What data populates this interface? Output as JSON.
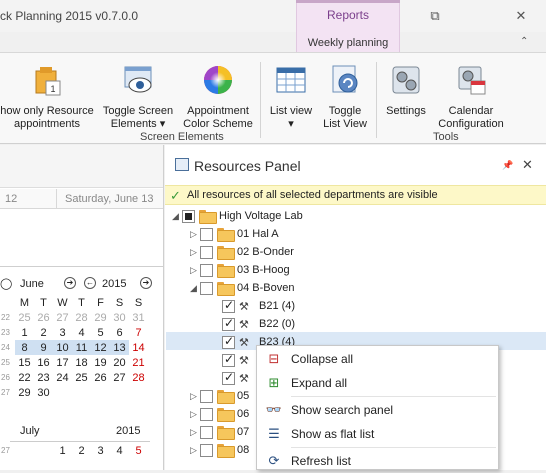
{
  "window": {
    "title": "ck Planning 2015 v0.7.0.0"
  },
  "ribbon_tabs": {
    "context_label": "Reports",
    "tab_label": "Weekly planning"
  },
  "ribbon": {
    "buttons": [
      {
        "label": "how only Resource\nappointments"
      },
      {
        "label": "Toggle Screen\nElements ▾"
      },
      {
        "label": "Appointment\nColor Scheme"
      },
      {
        "label": "List view\n▾"
      },
      {
        "label": "Toggle\nList View"
      },
      {
        "label": "Settings"
      },
      {
        "label": "Calendar\nConfiguration"
      }
    ],
    "groups": [
      "Screen Elements",
      "Tools"
    ]
  },
  "scheduler": {
    "day_left": "12",
    "day_right": "Saturday, June 13"
  },
  "calendar": {
    "june": {
      "month": "June",
      "year": "2015",
      "weekdays": [
        "M",
        "T",
        "W",
        "T",
        "F",
        "S",
        "S"
      ],
      "weeks": [
        {
          "wk": "22",
          "days": [
            "25",
            "26",
            "27",
            "28",
            "29",
            "30",
            "31"
          ]
        },
        {
          "wk": "23",
          "days": [
            "1",
            "2",
            "3",
            "4",
            "5",
            "6",
            "7"
          ]
        },
        {
          "wk": "24",
          "days": [
            "8",
            "9",
            "10",
            "11",
            "12",
            "13",
            "14"
          ]
        },
        {
          "wk": "25",
          "days": [
            "15",
            "16",
            "17",
            "18",
            "19",
            "20",
            "21"
          ]
        },
        {
          "wk": "26",
          "days": [
            "22",
            "23",
            "24",
            "25",
            "26",
            "27",
            "28"
          ]
        },
        {
          "wk": "27",
          "days": [
            "29",
            "30",
            "",
            "",
            "",
            "",
            ""
          ]
        }
      ]
    },
    "july": {
      "month": "July",
      "year": "2015",
      "weeks": [
        {
          "wk": "27",
          "days": [
            "",
            "",
            "1",
            "2",
            "3",
            "4",
            "5"
          ]
        }
      ]
    }
  },
  "panel": {
    "title": "Resources Panel",
    "banner": "All resources of all selected departments are visible",
    "tree": [
      {
        "label": "High Voltage Lab"
      },
      {
        "label": "01 Hal A"
      },
      {
        "label": "02 B-Onder"
      },
      {
        "label": "03 B-Hoog"
      },
      {
        "label": "04 B-Boven"
      },
      {
        "label": "B21 (4)"
      },
      {
        "label": "B22 (0)"
      },
      {
        "label": "B23 (4)"
      },
      {
        "label": "05 "
      },
      {
        "label": "06 "
      },
      {
        "label": "07 "
      },
      {
        "label": "08 "
      }
    ]
  },
  "context_menu": {
    "items": [
      {
        "label": "Collapse all",
        "icon": "collapse-all-icon"
      },
      {
        "label": "Expand all",
        "icon": "expand-all-icon"
      },
      {
        "label": "Show search panel",
        "icon": "binoculars-icon"
      },
      {
        "label": "Show as flat list",
        "icon": "list-icon"
      },
      {
        "label": "Refresh list",
        "icon": "refresh-icon"
      }
    ]
  }
}
